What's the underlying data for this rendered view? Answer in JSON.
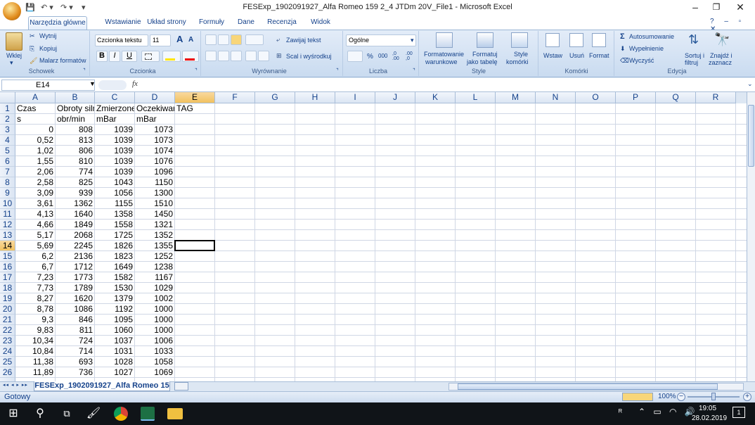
{
  "window": {
    "title": "FESExp_1902091927_Alfa Romeo 159 2_4 JTDm 20V_File1 - Microsoft Excel",
    "minimize": "–",
    "restore": "❐",
    "close": "✕"
  },
  "qat": {
    "save": "💾",
    "undo": "↶ ▾",
    "redo": "↷ ▾",
    "more": "▾"
  },
  "tabs": [
    "Narzędzia główne",
    "Wstawianie",
    "Układ strony",
    "Formuły",
    "Dane",
    "Recenzja",
    "Widok"
  ],
  "ribbon": {
    "schowek": {
      "paste": "Wklej",
      "cut": "Wytnij",
      "copy": "Kopiuj",
      "painter": "Malarz formatów",
      "label": "Schowek"
    },
    "czcionka": {
      "font": "Czcionka tekstu",
      "size": "11",
      "grow": "A",
      "shrink": "A",
      "bold": "B",
      "italic": "I",
      "underline": "U",
      "label": "Czcionka"
    },
    "wyrownanie": {
      "wrap": "Zawijaj tekst",
      "merge": "Scal i wyśrodkuj",
      "label": "Wyrównanie"
    },
    "liczba": {
      "format": "Ogólne",
      "percent": "%",
      "thousands": "000",
      "inc": ",0 .00",
      "dec": ".00 ,0",
      "label": "Liczba"
    },
    "style": {
      "cond1": "Formatowanie",
      "cond2": "warunkowe",
      "table1": "Formatuj",
      "table2": "jako tabelę",
      "cell1": "Style",
      "cell2": "komórki",
      "label": "Style"
    },
    "komorki": {
      "insert": "Wstaw",
      "delete": "Usuń",
      "format": "Format",
      "label": "Komórki"
    },
    "edycja": {
      "autosum": "Autosumowanie",
      "fill": "Wypełnienie",
      "clear": "Wyczyść",
      "sort1": "Sortuj i",
      "sort2": "filtruj",
      "find1": "Znajdź i",
      "find2": "zaznacz",
      "label": "Edycja"
    }
  },
  "formula": {
    "namebox": "E14",
    "fx": "fx",
    "value": ""
  },
  "columns": [
    "A",
    "B",
    "C",
    "D",
    "E",
    "F",
    "G",
    "H",
    "I",
    "J",
    "K",
    "L",
    "M",
    "N",
    "O",
    "P",
    "Q",
    "R"
  ],
  "active_cell": "E14",
  "rows": [
    {
      "n": "1",
      "a": "Czas",
      "b": "Obroty siln",
      "c": "Zmierzone",
      "d": "Oczekiwar",
      "e": "TAG"
    },
    {
      "n": "2",
      "a": "s",
      "b": "obr/min",
      "c": "mBar",
      "d": "mBar",
      "e": ""
    },
    {
      "n": "3",
      "a": "0",
      "b": "808",
      "c": "1039",
      "d": "1073",
      "e": ""
    },
    {
      "n": "4",
      "a": "0,52",
      "b": "813",
      "c": "1039",
      "d": "1073",
      "e": ""
    },
    {
      "n": "5",
      "a": "1,02",
      "b": "806",
      "c": "1039",
      "d": "1074",
      "e": ""
    },
    {
      "n": "6",
      "a": "1,55",
      "b": "810",
      "c": "1039",
      "d": "1076",
      "e": ""
    },
    {
      "n": "7",
      "a": "2,06",
      "b": "774",
      "c": "1039",
      "d": "1096",
      "e": ""
    },
    {
      "n": "8",
      "a": "2,58",
      "b": "825",
      "c": "1043",
      "d": "1150",
      "e": ""
    },
    {
      "n": "9",
      "a": "3,09",
      "b": "939",
      "c": "1056",
      "d": "1300",
      "e": ""
    },
    {
      "n": "10",
      "a": "3,61",
      "b": "1362",
      "c": "1155",
      "d": "1510",
      "e": ""
    },
    {
      "n": "11",
      "a": "4,13",
      "b": "1640",
      "c": "1358",
      "d": "1450",
      "e": ""
    },
    {
      "n": "12",
      "a": "4,66",
      "b": "1849",
      "c": "1558",
      "d": "1321",
      "e": ""
    },
    {
      "n": "13",
      "a": "5,17",
      "b": "2068",
      "c": "1725",
      "d": "1352",
      "e": ""
    },
    {
      "n": "14",
      "a": "5,69",
      "b": "2245",
      "c": "1826",
      "d": "1355",
      "e": ""
    },
    {
      "n": "15",
      "a": "6,2",
      "b": "2136",
      "c": "1823",
      "d": "1252",
      "e": ""
    },
    {
      "n": "16",
      "a": "6,7",
      "b": "1712",
      "c": "1649",
      "d": "1238",
      "e": ""
    },
    {
      "n": "17",
      "a": "7,23",
      "b": "1773",
      "c": "1582",
      "d": "1167",
      "e": ""
    },
    {
      "n": "18",
      "a": "7,73",
      "b": "1789",
      "c": "1530",
      "d": "1029",
      "e": ""
    },
    {
      "n": "19",
      "a": "8,27",
      "b": "1620",
      "c": "1379",
      "d": "1002",
      "e": ""
    },
    {
      "n": "20",
      "a": "8,78",
      "b": "1086",
      "c": "1192",
      "d": "1000",
      "e": ""
    },
    {
      "n": "21",
      "a": "9,3",
      "b": "846",
      "c": "1095",
      "d": "1000",
      "e": ""
    },
    {
      "n": "22",
      "a": "9,83",
      "b": "811",
      "c": "1060",
      "d": "1000",
      "e": ""
    },
    {
      "n": "23",
      "a": "10,34",
      "b": "724",
      "c": "1037",
      "d": "1006",
      "e": ""
    },
    {
      "n": "24",
      "a": "10,84",
      "b": "714",
      "c": "1031",
      "d": "1033",
      "e": ""
    },
    {
      "n": "25",
      "a": "11,38",
      "b": "693",
      "c": "1028",
      "d": "1058",
      "e": ""
    },
    {
      "n": "26",
      "a": "11,89",
      "b": "736",
      "c": "1027",
      "d": "1069",
      "e": ""
    }
  ],
  "sheet": {
    "nav": "◂◂ ◂ ▸ ▸▸",
    "name": "FESExp_1902091927_Alfa Romeo 15"
  },
  "status": {
    "text": "Gotowy",
    "zoom": "100%"
  },
  "taskbar": {
    "time": "19:05",
    "date": "28.02.2019",
    "notifications": "1"
  }
}
